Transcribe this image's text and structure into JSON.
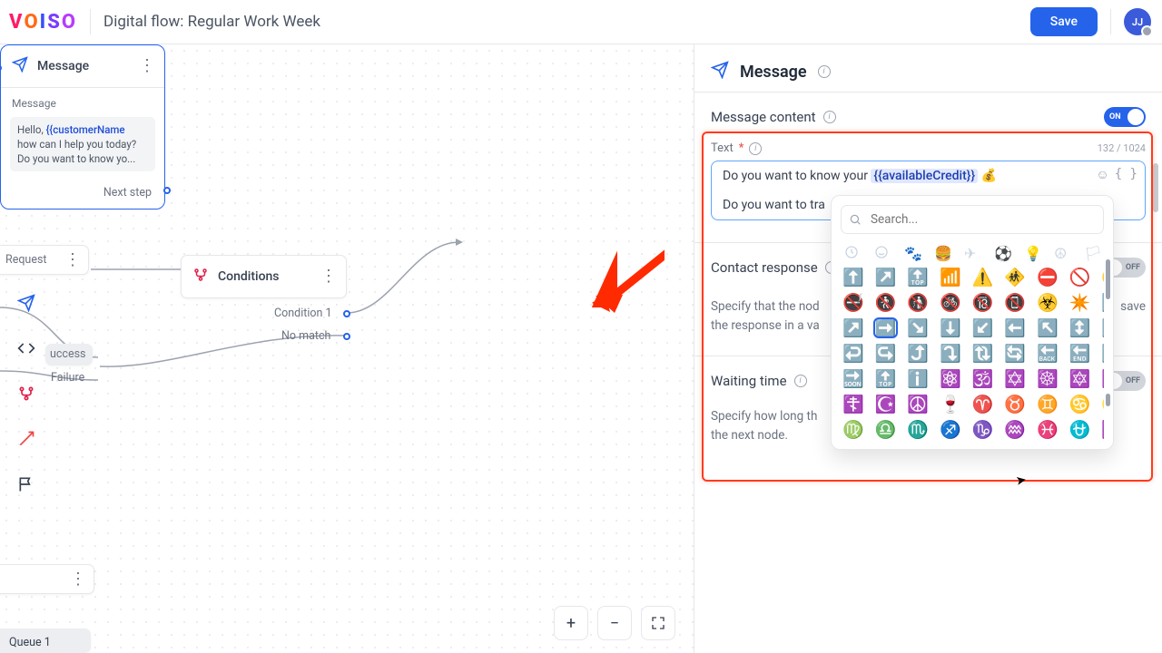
{
  "header": {
    "logo_letters": [
      "V",
      "O",
      "I",
      "S",
      "O"
    ],
    "title": "Digital flow: Regular Work Week",
    "save_label": "Save",
    "avatar_initials": "JJ"
  },
  "canvas": {
    "left_request_label": "Request",
    "left_success_label": "uccess",
    "left_failure_label": "Failure",
    "left_queue_chip": "Queue 1",
    "conditions": {
      "title": "Conditions",
      "port1": "Condition 1",
      "port2": "No match"
    },
    "message_node": {
      "title": "Message",
      "section_label": "Message",
      "line1_prefix": "Hello, ",
      "line1_token": "{{customerName",
      "line2": "how can I help you today?",
      "line3": "Do you want to know yo...",
      "next_step": "Next step"
    }
  },
  "panel": {
    "title": "Message",
    "content_section": "Message content",
    "toggle_on": "ON",
    "text_label": "Text",
    "counter": "132 / 1024",
    "text_line1_prefix": "Do you want to know your ",
    "text_line1_token": "{{availableCredit}}",
    "text_line1_emoji": "💰",
    "text_line2": "Do you want to tra",
    "contact_section": "Contact response",
    "contact_desc_1": "Specify that the nod",
    "contact_desc_2a": "save",
    "contact_desc_2b": "the response in a va",
    "waiting_section": "Waiting time",
    "waiting_desc_1": "Specify how long th",
    "waiting_desc_2": "the next node.",
    "toggle_off": "OFF"
  },
  "picker": {
    "placeholder": "Search...",
    "emoji_rows": [
      [
        "⬆️",
        "↗️",
        "🔝",
        "📶",
        "⚠️",
        "🚸",
        "⛔",
        "🚫",
        "☢️"
      ],
      [
        "🚭",
        "🚷",
        "🚯",
        "🚳",
        "🔞",
        "📵",
        "☣️",
        "✴️",
        "⬆️"
      ],
      [
        "↗️",
        "➡️",
        "↘️",
        "⬇️",
        "↙️",
        "⬅️",
        "↖️",
        "↕️",
        "↔️"
      ],
      [
        "↩️",
        "↪️",
        "⤴️",
        "⤵️",
        "🔃",
        "🔄",
        "🔙",
        "🔚",
        "🔛"
      ],
      [
        "🔜",
        "🔝",
        "ℹ️",
        "⚛️",
        "🕉️",
        "✡️",
        "☸️",
        "🔯",
        "✝️"
      ],
      [
        "☦️",
        "☪️",
        "☮️",
        "🍷",
        "♈",
        "♉",
        "♊",
        "♋",
        "♌"
      ],
      [
        "♍",
        "♎",
        "♏",
        "♐",
        "♑",
        "♒",
        "♓",
        "⛎",
        "🆔"
      ]
    ],
    "selected_emoji_index": 19
  }
}
